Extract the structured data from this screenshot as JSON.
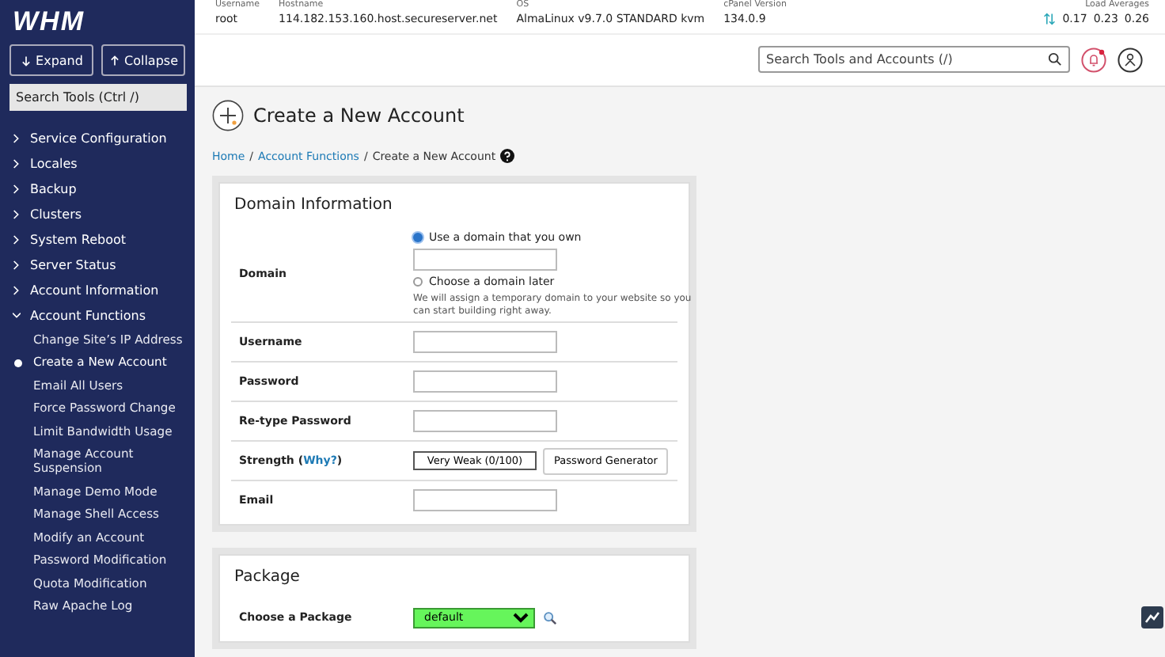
{
  "sidebar": {
    "logo": "WHM",
    "buttons": [
      {
        "kind": "down",
        "label": "Expand"
      },
      {
        "kind": "up",
        "label": "Collapse"
      }
    ],
    "search": {
      "placeholder": "Search Tools (Ctrl /)"
    },
    "items": [
      {
        "label": "Service Configuration",
        "expanded": false
      },
      {
        "label": "Locales",
        "expanded": false
      },
      {
        "label": "Backup",
        "expanded": false
      },
      {
        "label": "Clusters",
        "expanded": false
      },
      {
        "label": "System Reboot",
        "expanded": false
      },
      {
        "label": "Server Status",
        "expanded": false
      },
      {
        "label": "Account Information",
        "expanded": false
      },
      {
        "label": "Account Functions",
        "expanded": true,
        "children": [
          {
            "label": "Change Site’s IP Address",
            "selected": false
          },
          {
            "label": "Create a New Account",
            "selected": true
          },
          {
            "label": "Email All Users",
            "selected": false
          },
          {
            "label": "Force Password Change",
            "selected": false
          },
          {
            "label": "Limit Bandwidth Usage",
            "selected": false
          },
          {
            "label": "Manage Account Suspension",
            "selected": false
          },
          {
            "label": "Manage Demo Mode",
            "selected": false
          },
          {
            "label": "Manage Shell Access",
            "selected": false
          },
          {
            "label": "Modify an Account",
            "selected": false
          },
          {
            "label": "Password Modification",
            "selected": false
          },
          {
            "label": "Quota Modification",
            "selected": false
          },
          {
            "label": "Raw Apache Log",
            "selected": false
          }
        ]
      }
    ]
  },
  "header": {
    "info": [
      {
        "label": "Username",
        "value": "root"
      },
      {
        "label": "Hostname",
        "value": "114.182.153.160.host.secureserver.net"
      },
      {
        "label": "OS",
        "value": "AlmaLinux v9.7.0 STANDARD kvm"
      },
      {
        "label": "cPanel Version",
        "value": "134.0.9"
      }
    ],
    "load": {
      "label": "Load Averages",
      "values": [
        "0.17",
        "0.23",
        "0.26"
      ]
    },
    "search": {
      "placeholder": "Search Tools and Accounts (/)"
    },
    "notifications": true
  },
  "page": {
    "title": "Create a New Account",
    "breadcrumb": [
      {
        "label": "Home",
        "link": true
      },
      {
        "label": "Account Functions",
        "link": true
      },
      {
        "label": "Create a New Account",
        "link": false
      }
    ],
    "separator": "/",
    "sections": [
      {
        "title": "Domain Information",
        "rows": [
          {
            "kind": "domain",
            "label": "Domain",
            "options": [
              {
                "label": "Use a domain that you own",
                "selected": true
              },
              {
                "label": "Choose a domain later",
                "selected": false,
                "note": "We will assign a temporary domain to your website so you can start building right away."
              }
            ]
          },
          {
            "kind": "text",
            "label": "Username"
          },
          {
            "kind": "text",
            "label": "Password"
          },
          {
            "kind": "text",
            "label": "Re-type Password"
          },
          {
            "kind": "strength",
            "label": "Strength (",
            "link": "Why?",
            "label_after": ")",
            "meter": {
              "text": "Very Weak (0/100)"
            },
            "button": "Password Generator"
          },
          {
            "kind": "text",
            "label": "Email"
          }
        ]
      },
      {
        "title": "Package",
        "rows": [
          {
            "kind": "select",
            "label": "Choose a Package",
            "value": "default"
          }
        ]
      }
    ]
  }
}
